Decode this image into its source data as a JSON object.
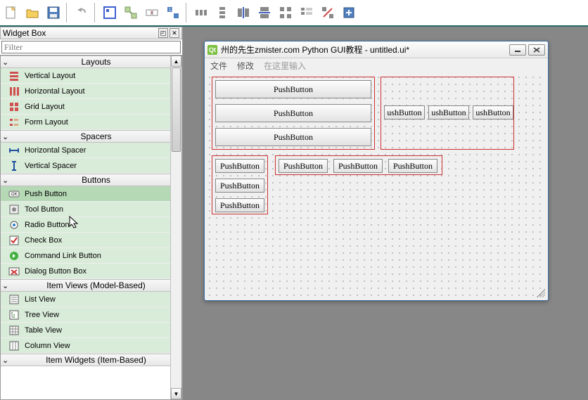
{
  "toolbar": {},
  "widget_box": {
    "title": "Widget Box",
    "filter_placeholder": "Filter",
    "categories": [
      {
        "name": "Layouts",
        "items": [
          {
            "label": "Vertical Layout",
            "icon": "vlayout"
          },
          {
            "label": "Horizontal Layout",
            "icon": "hlayout"
          },
          {
            "label": "Grid Layout",
            "icon": "glayout"
          },
          {
            "label": "Form Layout",
            "icon": "flayout"
          }
        ]
      },
      {
        "name": "Spacers",
        "items": [
          {
            "label": "Horizontal Spacer",
            "icon": "hspacer"
          },
          {
            "label": "Vertical Spacer",
            "icon": "vspacer"
          }
        ]
      },
      {
        "name": "Buttons",
        "items": [
          {
            "label": "Push Button",
            "icon": "pushbtn",
            "sel": true
          },
          {
            "label": "Tool Button",
            "icon": "toolbtn"
          },
          {
            "label": "Radio Button",
            "icon": "radiobtn"
          },
          {
            "label": "Check Box",
            "icon": "checkbox"
          },
          {
            "label": "Command Link Button",
            "icon": "cmdlink"
          },
          {
            "label": "Dialog Button Box",
            "icon": "dlgbox"
          }
        ]
      },
      {
        "name": "Item Views (Model-Based)",
        "items": [
          {
            "label": "List View",
            "icon": "listview"
          },
          {
            "label": "Tree View",
            "icon": "treeview"
          },
          {
            "label": "Table View",
            "icon": "tableview"
          },
          {
            "label": "Column View",
            "icon": "colview"
          }
        ]
      },
      {
        "name": "Item Widgets (Item-Based)",
        "items": []
      }
    ]
  },
  "form": {
    "title": "州的先生zmister.com Python GUI教程 - untitled.ui*",
    "menu": {
      "file": "文件",
      "edit": "修改",
      "type_here": "在这里输入"
    },
    "btn_label": "PushButton",
    "btn_label_clip": "ushButton"
  }
}
